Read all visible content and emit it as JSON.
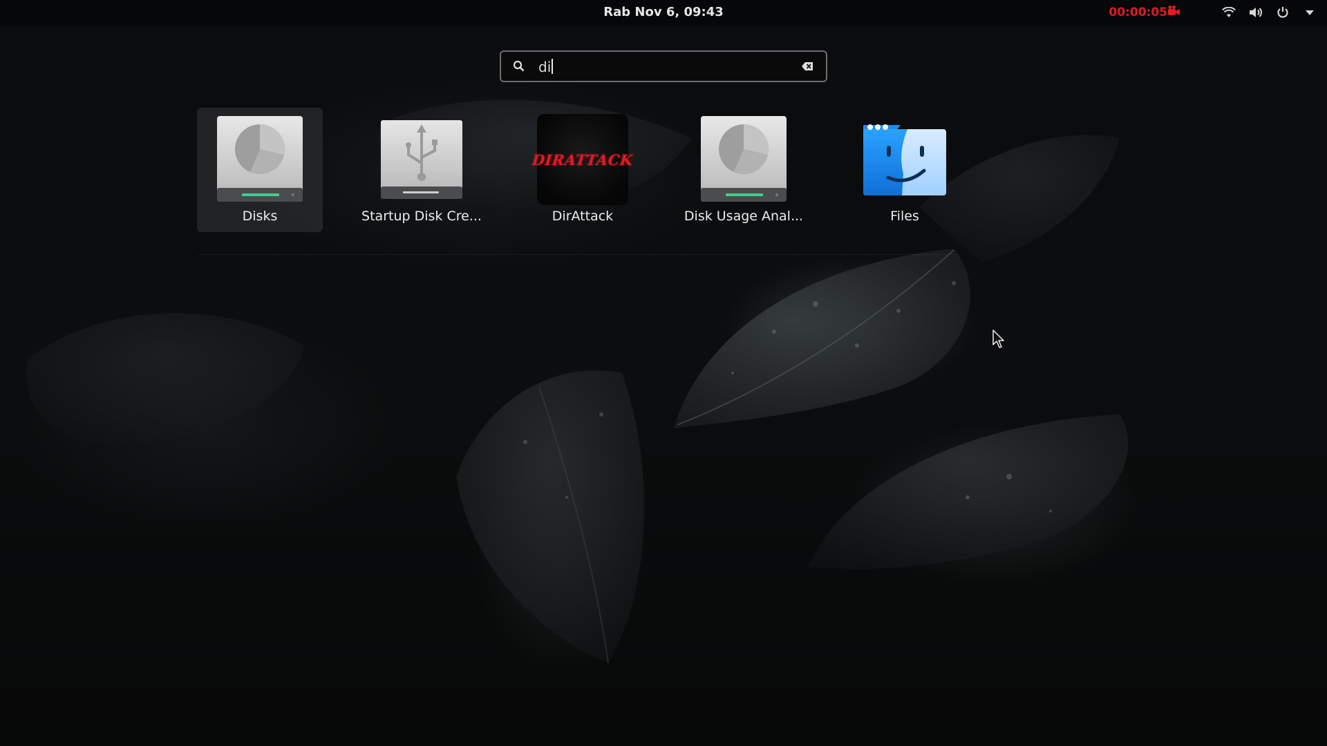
{
  "topbar": {
    "clock": "Rab Nov  6, 09:43",
    "recording_time": "00:00:05",
    "icons": [
      "recording-icon",
      "wifi-icon",
      "volume-icon",
      "power-icon",
      "menu-arrow-icon"
    ]
  },
  "search": {
    "value": "di",
    "icon": "search-icon",
    "clear_icon": "clear-icon"
  },
  "results": [
    {
      "label": "Disks",
      "icon": "disks-icon",
      "selected": true
    },
    {
      "label": "Startup Disk Cre...",
      "icon": "usb-drive-icon",
      "selected": false
    },
    {
      "label": "DirAttack",
      "icon": "dirattack-icon",
      "icon_text": "DIRATTACK",
      "selected": false
    },
    {
      "label": "Disk Usage Anal...",
      "icon": "disk-usage-icon",
      "selected": false
    },
    {
      "label": "Files",
      "icon": "files-icon",
      "selected": false
    }
  ],
  "colors": {
    "recording": "#e01b24",
    "selection": "#3c3e40",
    "drive_led": "#3fd08f",
    "files_blue": "#1e90e8"
  }
}
